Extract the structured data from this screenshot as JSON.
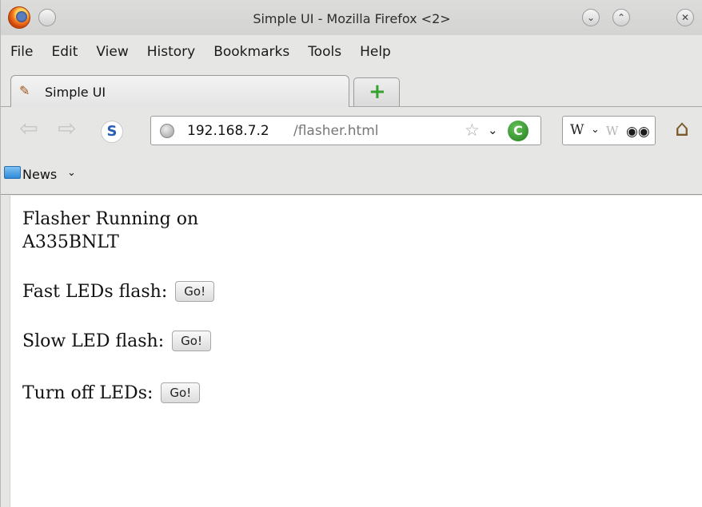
{
  "window": {
    "title": "Simple UI - Mozilla Firefox <2>",
    "controls": {
      "menu": "◦",
      "minimize": "⌄",
      "maximize": "⌃",
      "close": "✕"
    }
  },
  "menubar": {
    "items": [
      {
        "label": "File"
      },
      {
        "label": "Edit"
      },
      {
        "label": "View"
      },
      {
        "label": "History"
      },
      {
        "label": "Bookmarks"
      },
      {
        "label": "Tools"
      },
      {
        "label": "Help"
      }
    ]
  },
  "tabs": {
    "active": {
      "label": "Simple UI",
      "icon": "terminal-favicon-icon"
    },
    "new_tab_symbol": "+"
  },
  "navigation": {
    "back_symbol": "⇦",
    "forward_symbol": "⇨",
    "s_icon_label": "S",
    "url_host": "192.168.7.2",
    "url_path": "/flasher.html",
    "bookmark_star": "☆",
    "dropdown_arrow": "⌄",
    "reload_symbol": "C",
    "search_engine_label": "W",
    "search_placeholder": "W",
    "search_icon_glyph": "⚲",
    "home_symbol": "⌂"
  },
  "bookmarks": {
    "folder_label": "News",
    "folder_chevron": "⌄"
  },
  "page": {
    "heading_line1": "Flasher Running on",
    "heading_line2": "A335BNLT",
    "rows": [
      {
        "label": "Fast LEDs flash:",
        "button": "Go!"
      },
      {
        "label": "Slow LED flash:",
        "button": "Go!"
      },
      {
        "label": "Turn off LEDs:",
        "button": "Go!"
      }
    ]
  },
  "colors": {
    "chrome_background": "#e6e6e5",
    "reload_green": "#2e8b2a",
    "newtab_plus_green": "#36a12d",
    "bookmark_folder_blue": "#2e8ad8"
  }
}
